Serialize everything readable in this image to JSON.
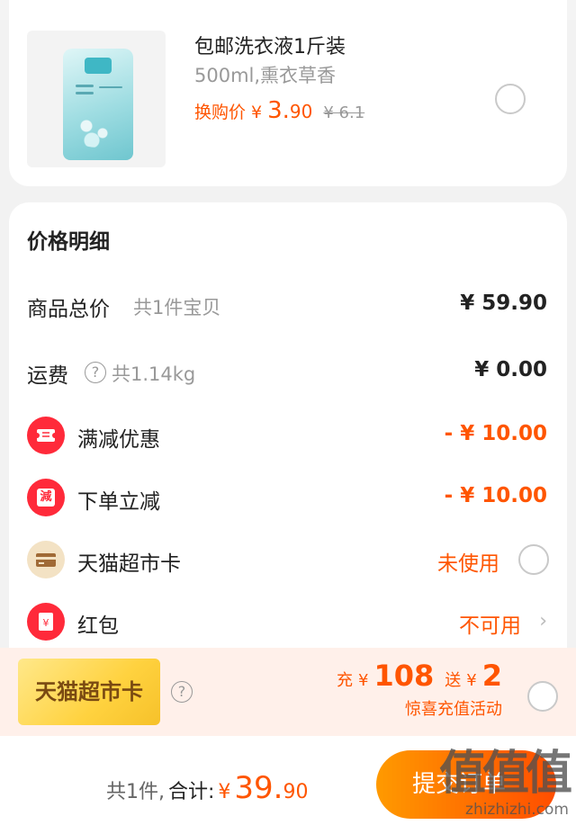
{
  "product": {
    "title": "包邮洗衣液1斤装",
    "spec": "500ml,熏衣草香",
    "price_label": "换购价",
    "currency": "¥",
    "price_int": "3.",
    "price_dec": "90",
    "original_price": "¥ 6.1"
  },
  "details": {
    "title": "价格明细",
    "goods_total": {
      "label": "商品总价",
      "sub": "共1件宝贝",
      "amount": "¥ 59.90"
    },
    "shipping": {
      "label": "运费",
      "sub": "共1.14kg",
      "amount": "¥ 0.00"
    },
    "full_discount": {
      "label": "满减优惠",
      "amount": "- ¥ 10.00",
      "icon": "ticket-icon"
    },
    "order_discount": {
      "label": "下单立减",
      "amount": "- ¥ 10.00",
      "icon": "discount-badge-icon",
      "icon_char": "減"
    },
    "tmall_card": {
      "label": "天猫超市卡",
      "status": "未使用",
      "icon": "card-icon"
    },
    "red_packet": {
      "label": "红包",
      "status": "不可用",
      "icon": "red-packet-icon"
    }
  },
  "promo": {
    "badge": "天猫超市卡",
    "charge_label": "充",
    "currency": "¥",
    "charge_amount": "108",
    "gift_label": "送",
    "gift_amount": "2",
    "activity": "惊喜充值活动"
  },
  "footer": {
    "count": "共1件,",
    "total_label": "合计:",
    "currency": "¥",
    "total_int": "39.",
    "total_dec": "90",
    "submit": "提交订单"
  },
  "watermark": {
    "logo": "值值值",
    "url": "zhizhizhi.com"
  },
  "colors": {
    "accent": "#ff5500",
    "red_icon": "#ff2a3a",
    "promo_bg": "#fff0ea"
  }
}
